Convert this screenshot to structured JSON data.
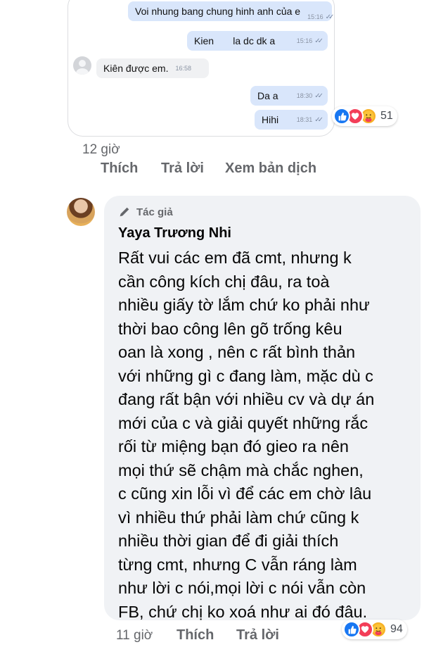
{
  "first_comment": {
    "chat": {
      "messages": [
        {
          "text": "Voi nhung bang chung hinh anh của e",
          "time": "15:16",
          "side": "out"
        },
        {
          "text": "Kien       la dc dk a",
          "time": "15:16",
          "side": "out"
        },
        {
          "text": "Kiên được em.",
          "time": "16:58",
          "side": "in"
        },
        {
          "text": "Da a",
          "time": "18:30",
          "side": "out"
        },
        {
          "text": "Hihi",
          "time": "18:31",
          "side": "out"
        }
      ],
      "tick_glyph": "✓✓"
    },
    "reactions": {
      "icons": [
        "like-icon",
        "love-icon",
        "care-icon"
      ],
      "count": "51"
    },
    "time": "12 giờ",
    "actions": {
      "like": "Thích",
      "reply": "Trả lời",
      "translate": "Xem bản dịch"
    }
  },
  "second_comment": {
    "badge": "Tác giả",
    "author": "Yaya Trương Nhi",
    "text_lines": [
      "Rất vui các em đã cmt, nhưng k",
      "cần công kích chị đâu, ra toà",
      "nhiều giấy tờ lắm chứ ko phải như",
      "thời bao công lên gõ trống kêu",
      "oan là xong , nên c rất bình thản",
      "với những gì c đang làm, mặc dù c",
      "đang rất bận với nhiều cv và dự án",
      "mới của c và giải quyết những rắc",
      "rối từ miệng bạn đó gieo ra nên",
      "mọi thứ sẽ chậm mà chắc nghen,",
      "c cũng xin lỗi vì để các em chờ lâu",
      "vì nhiều thứ phải làm chứ cũng k",
      "nhiều thời gian để đi giải thích",
      "từng cmt, nhưng C vẫn ráng làm",
      "như lời c nói,mọi lời c nói vẫn còn",
      "FB, chứ chị ko xoá như ai đó đâu."
    ],
    "reactions": {
      "icons": [
        "like-icon",
        "love-icon",
        "care-icon"
      ],
      "count": "94"
    },
    "time": "11 giờ",
    "actions": {
      "like": "Thích",
      "reply": "Trả lời"
    }
  },
  "colors": {
    "outgoing_bubble": "#d9e6fb",
    "incoming_bubble": "#f0f1f3",
    "comment_bubble": "#f0f2f5",
    "like": "#1877f2",
    "love": "#f33e58",
    "care": "#f7b125",
    "secondary_text": "#65676b"
  }
}
